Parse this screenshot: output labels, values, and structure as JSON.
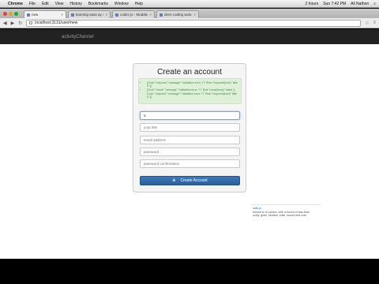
{
  "menubar": {
    "app": "Chrome",
    "items": [
      "File",
      "Edit",
      "View",
      "History",
      "Bookmarks",
      "Window",
      "Help"
    ],
    "right": [
      "2 hours",
      "Sun 7:42 PM",
      "Ali Nathon"
    ]
  },
  "tabs": [
    {
      "label": "new",
      "active": true
    },
    {
      "label": "learning saas ay ours",
      "active": false
    },
    {
      "label": "codez.js - Modded by Ch",
      "active": false
    },
    {
      "label": "devs coding wuts anti",
      "active": false
    }
  ],
  "address": {
    "url": "localhost:3131/user/new"
  },
  "appnav": {
    "brand": "activityChannel"
  },
  "form": {
    "title": "Create an account",
    "errors": [
      "[{\"rule\":\"required\",\"message\":\"Validation error: \\\"\\\" Rule \\\"required(true)\\\" failed.\"}]",
      "[{\"rule\":\"email\",\"message\":\"Validation error: \\\"\\\" Rule \\\"email(true)\\\" failed.\"},{\"rule\":\"required\",\"message\":\"Validation error: \\\"\\\" Rule \\\"required(true)\\\" failed.\"}]"
    ],
    "fields": [
      {
        "value": "a",
        "placeholder": ""
      },
      {
        "value": "",
        "placeholder": "your title"
      },
      {
        "value": "",
        "placeholder": "email address"
      },
      {
        "value": "",
        "placeholder": "password"
      },
      {
        "value": "",
        "placeholder": "password confirmation"
      }
    ],
    "submit_label": "Create Account"
  },
  "snippet": {
    "link": "sails.js",
    "text": "tutorial to Irl canton, with a bunch of less than ovely, geas, heather, elise, sound and coal"
  }
}
